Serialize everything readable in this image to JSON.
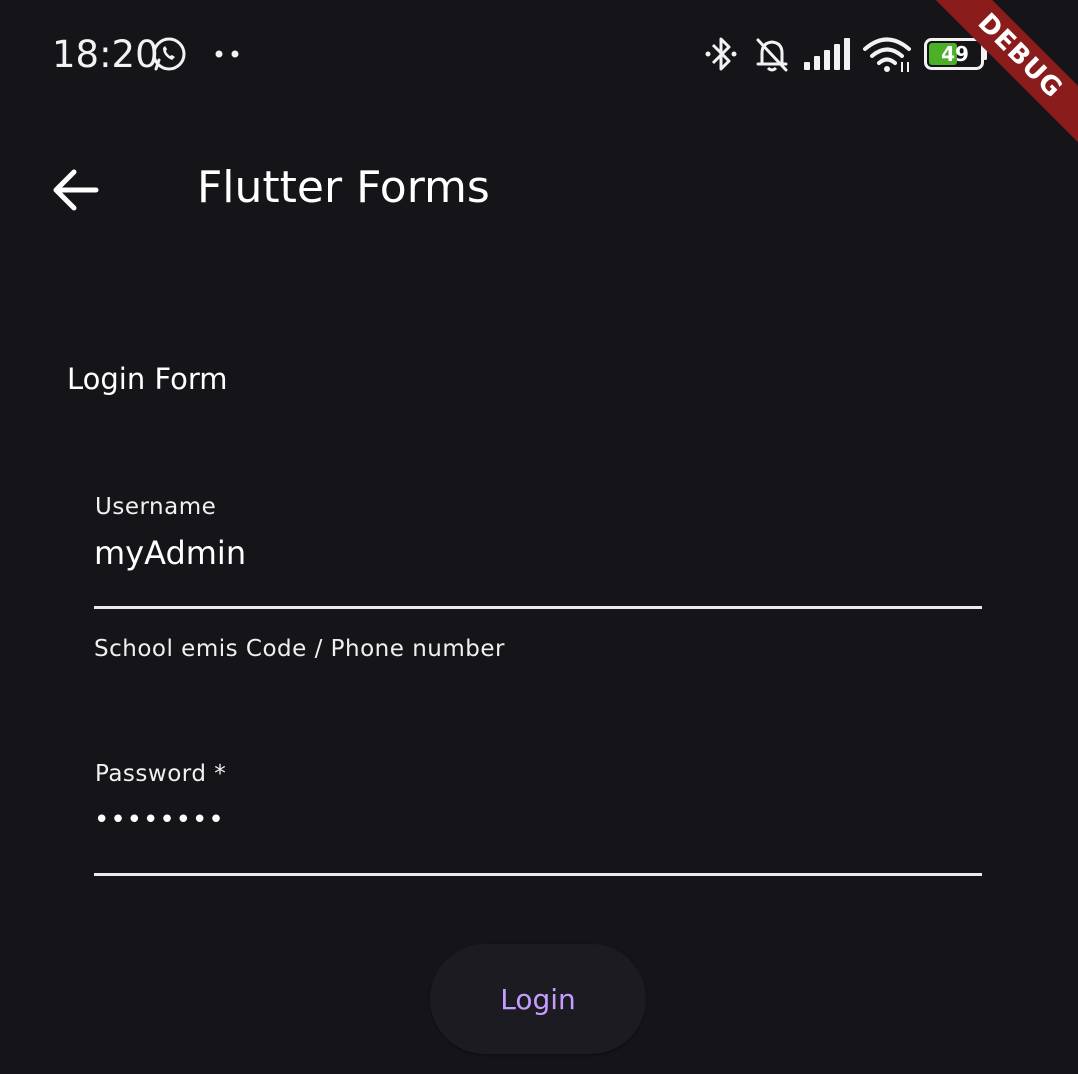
{
  "status_bar": {
    "time": "18:20",
    "battery_level": "49",
    "icons": [
      "whatsapp-icon",
      "more-dots-icon",
      "bluetooth-icon",
      "bell-muted-icon",
      "signal-icon",
      "wifi-icon",
      "battery-icon"
    ]
  },
  "debug_banner": {
    "label": "DEBUG",
    "color": "#8a1c1c"
  },
  "app_bar": {
    "title": "Flutter Forms",
    "back_icon": "arrow-back-icon"
  },
  "form": {
    "heading": "Login Form",
    "username": {
      "label": "Username",
      "value": "myAdmin",
      "helper": "School emis Code / Phone number"
    },
    "password": {
      "label": "Password *",
      "value": "••••••••"
    },
    "submit_label": "Login"
  },
  "colors": {
    "background": "#151419",
    "accent": "#c59cff",
    "battery_fill": "#4caf28"
  }
}
